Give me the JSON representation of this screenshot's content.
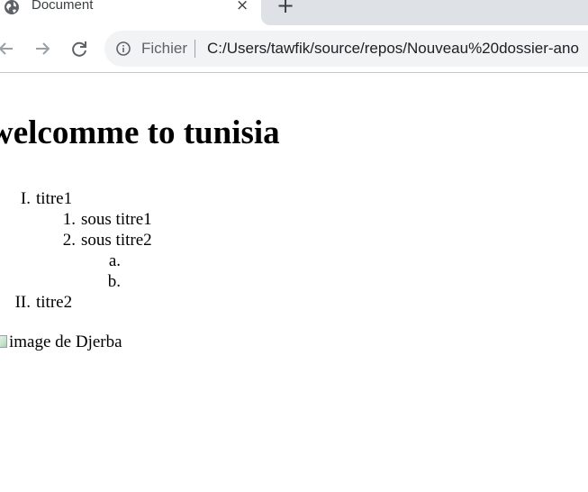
{
  "tab": {
    "title": "Document",
    "close_glyph": "×",
    "icon": "globe-icon"
  },
  "new_tab": {
    "glyph": "+"
  },
  "toolbar": {
    "back_icon": "arrow-left-icon",
    "forward_icon": "arrow-right-icon",
    "reload_icon": "reload-icon",
    "info_icon": "info-icon",
    "scheme_label": "Fichier",
    "url": "C:/Users/tawfik/source/repos/Nouveau%20dossier-ano"
  },
  "page": {
    "heading": "welcomme to tunisia",
    "list": [
      {
        "marker": "I.",
        "text": "titre1"
      },
      {
        "marker": "1.",
        "text": "sous titre1"
      },
      {
        "marker": "2.",
        "text": "sous titre2"
      },
      {
        "marker": "a.",
        "text": ""
      },
      {
        "marker": "b.",
        "text": ""
      },
      {
        "marker": "II.",
        "text": "titre2"
      }
    ],
    "image_alt": "image de Djerba"
  },
  "colors": {
    "tabstrip_bg": "#dee1e6",
    "omnibox_bg": "#f1f3f4",
    "text_primary": "#202124",
    "text_secondary": "#5f6368"
  }
}
